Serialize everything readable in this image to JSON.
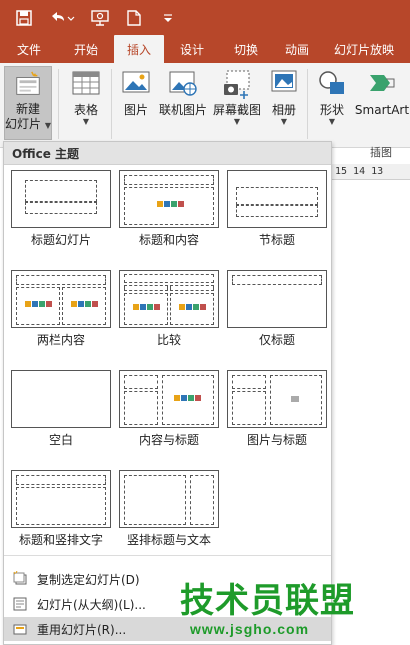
{
  "quick_access": {
    "icons": [
      "save-icon",
      "undo-icon",
      "slideshow-from-start-icon",
      "new-file-icon",
      "customize-dropdown-icon"
    ]
  },
  "tabs": [
    {
      "label": "文件",
      "active": false
    },
    {
      "label": "开始",
      "active": false
    },
    {
      "label": "插入",
      "active": true
    },
    {
      "label": "设计",
      "active": false
    },
    {
      "label": "切换",
      "active": false
    },
    {
      "label": "动画",
      "active": false
    },
    {
      "label": "幻灯片放映",
      "active": false
    }
  ],
  "ribbon": {
    "new_slide_label": "新建",
    "new_slide_label2": "幻灯片",
    "table_label": "表格",
    "picture_label": "图片",
    "online_picture_label": "联机图片",
    "screenshot_label": "屏幕截图",
    "album_label": "相册",
    "shapes_label": "形状",
    "smartart_label": "SmartArt",
    "group_illustrations": "插图"
  },
  "ruler": {
    "ticks": [
      "15",
      "14",
      "13"
    ]
  },
  "dropdown": {
    "header": "Office 主题",
    "layouts": [
      {
        "name": "标题幻灯片"
      },
      {
        "name": "标题和内容"
      },
      {
        "name": "节标题"
      },
      {
        "name": "两栏内容"
      },
      {
        "name": "比较"
      },
      {
        "name": "仅标题"
      },
      {
        "name": "空白"
      },
      {
        "name": "内容与标题"
      },
      {
        "name": "图片与标题"
      },
      {
        "name": "标题和竖排文字"
      },
      {
        "name": "竖排标题与文本"
      }
    ],
    "menu": [
      {
        "label": "复制选定幻灯片(D)"
      },
      {
        "label": "幻灯片(从大纲)(L)..."
      },
      {
        "label": "重用幻灯片(R)..."
      }
    ]
  },
  "watermark": {
    "text": "技术员联盟",
    "url": "www.jsgho.com"
  },
  "colors": {
    "accent": "#b7472a",
    "ribbon_bg": "#f3f3f3",
    "watermark": "#1e9b2a"
  }
}
